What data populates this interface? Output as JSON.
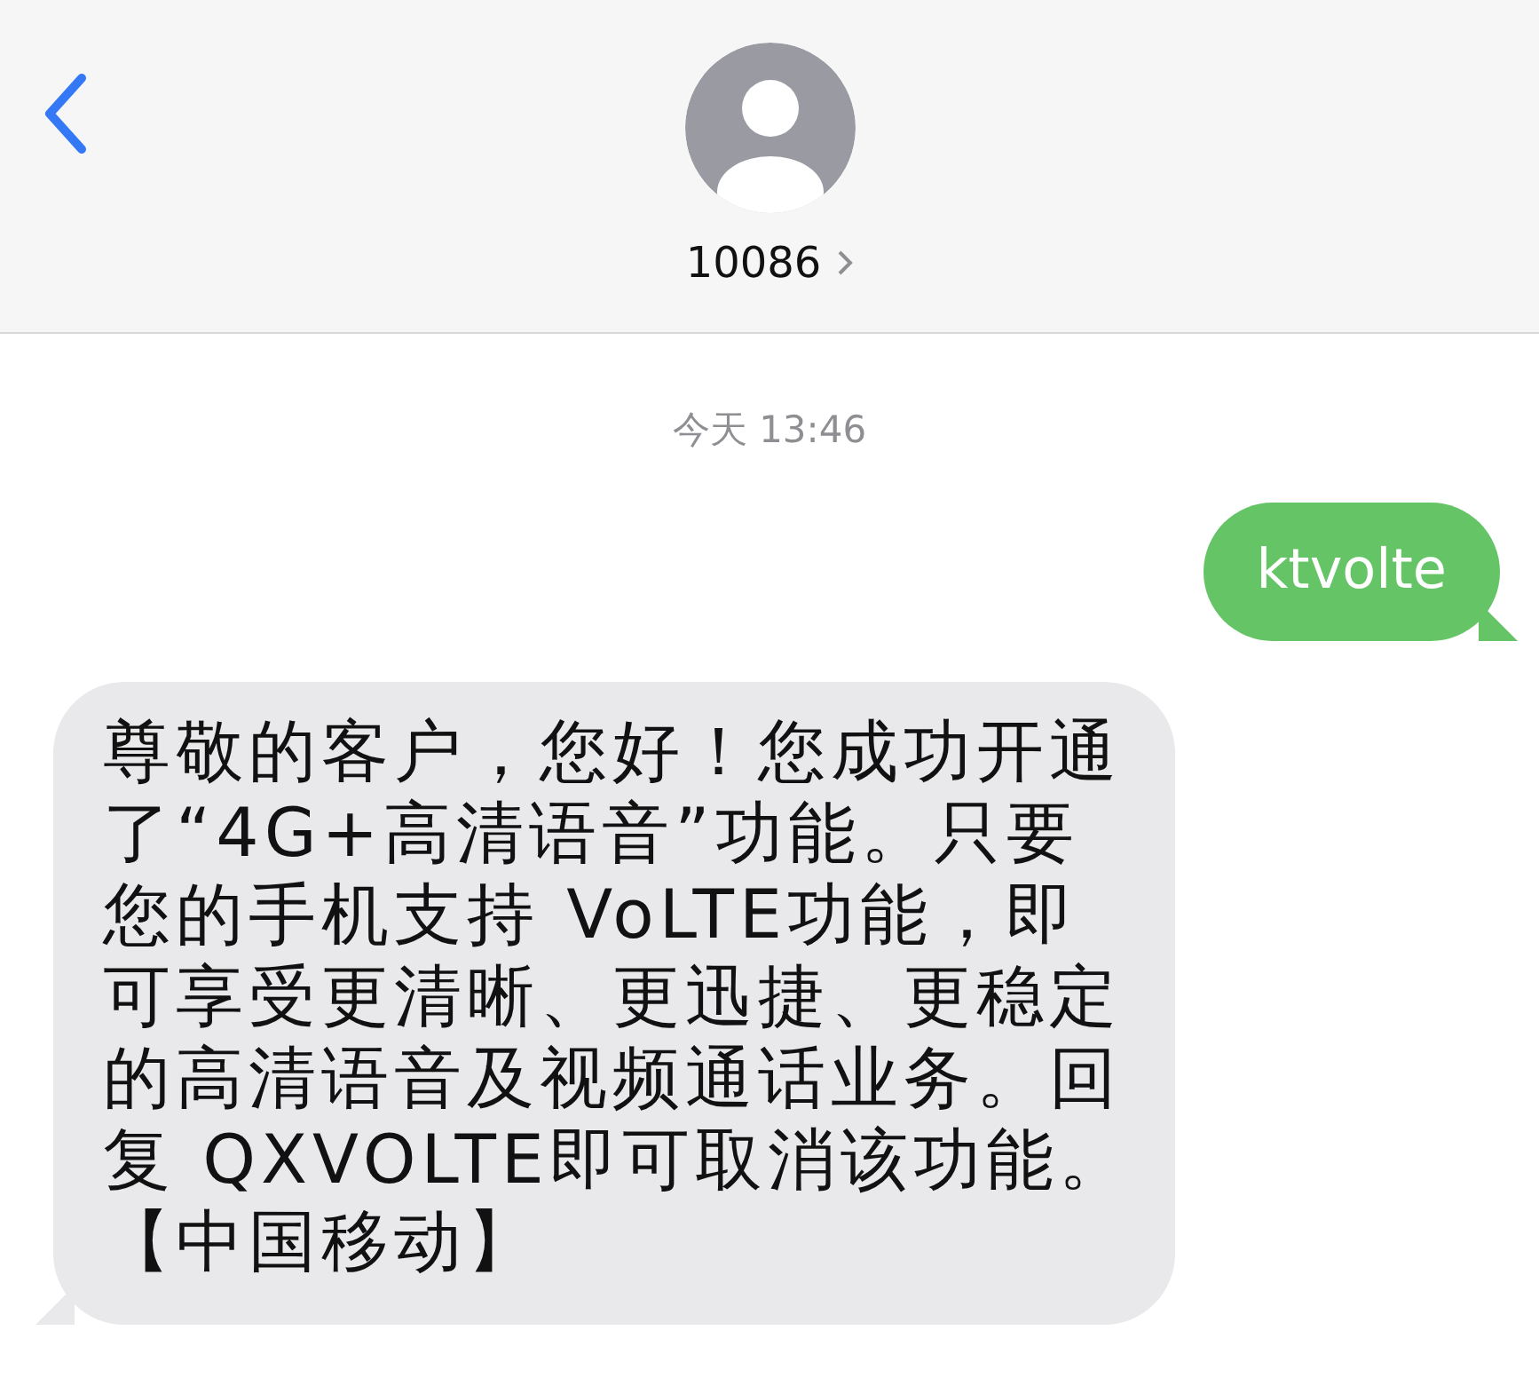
{
  "header": {
    "contact": "10086"
  },
  "timestamp": "今天 13:46",
  "messages": [
    {
      "kind": "sent",
      "text": "ktvolte"
    },
    {
      "kind": "received",
      "text": "尊敬的客户，您好！您成功开通了“4G+高清语音”功能。只要您的手机支持 VoLTE功能，即可享受更清晰、更迅捷、更稳定的高清语音及视频通话业务。回复 QXVOLTE即可取消该功能。【中国移动】"
    }
  ]
}
